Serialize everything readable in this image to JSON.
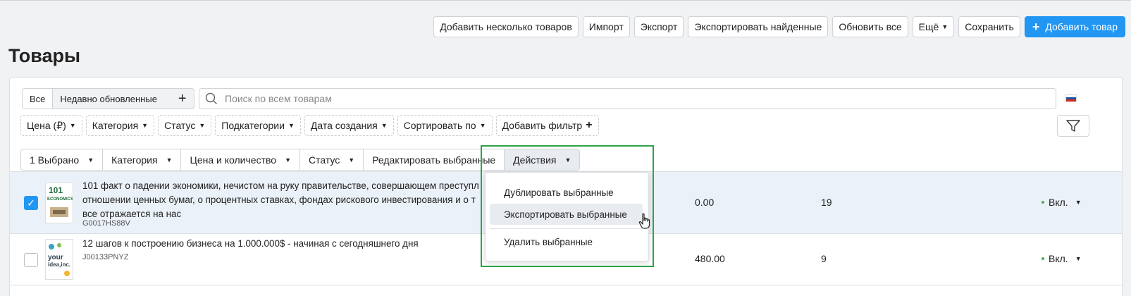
{
  "toolbar": {
    "add_multiple": "Добавить несколько товаров",
    "import": "Импорт",
    "export": "Экспорт",
    "export_found": "Экспортировать найденные",
    "update_all": "Обновить все",
    "more": "Ещё",
    "save": "Сохранить",
    "add_product": "Добавить товар"
  },
  "page": {
    "title": "Товары"
  },
  "views": {
    "all": "Все",
    "recent": "Недавно обновленные",
    "add": "+"
  },
  "search": {
    "placeholder": "Поиск по всем товарам"
  },
  "filters": [
    "Цена (₽)",
    "Категория",
    "Статус",
    "Подкатегории",
    "Дата создания",
    "Сортировать по",
    "Добавить фильтр"
  ],
  "bulk": {
    "selected": "1 Выбрано",
    "category": "Категория",
    "price_qty": "Цена и количество",
    "status": "Статус",
    "edit_selected": "Редактировать выбранные",
    "actions": "Действия"
  },
  "actions_menu": {
    "duplicate": "Дублировать выбранные",
    "export": "Экспортировать выбранные",
    "delete": "Удалить выбранные"
  },
  "products": [
    {
      "name_line1": "101 факт о падении экономики, нечистом на руку правительстве, совершающем преступл",
      "name_line2": "отношении ценных бумаг, о процентных ставках, фондах рискового инвестирования и о т",
      "name_line3": "все отражается на нас",
      "sku": "G0017HS88V",
      "price": "0.00",
      "qty": "19",
      "status": "Вкл.",
      "checked": true
    },
    {
      "name_line1": "12 шагов к построению бизнеса на 1.000.000$ - начиная с сегодняшнего дня",
      "sku": "J00133PNYZ",
      "price": "480.00",
      "qty": "9",
      "status": "Вкл.",
      "checked": false
    }
  ],
  "colors": {
    "primary": "#2196f3",
    "highlight": "#2ca34a",
    "status_on": "#4caf50"
  }
}
